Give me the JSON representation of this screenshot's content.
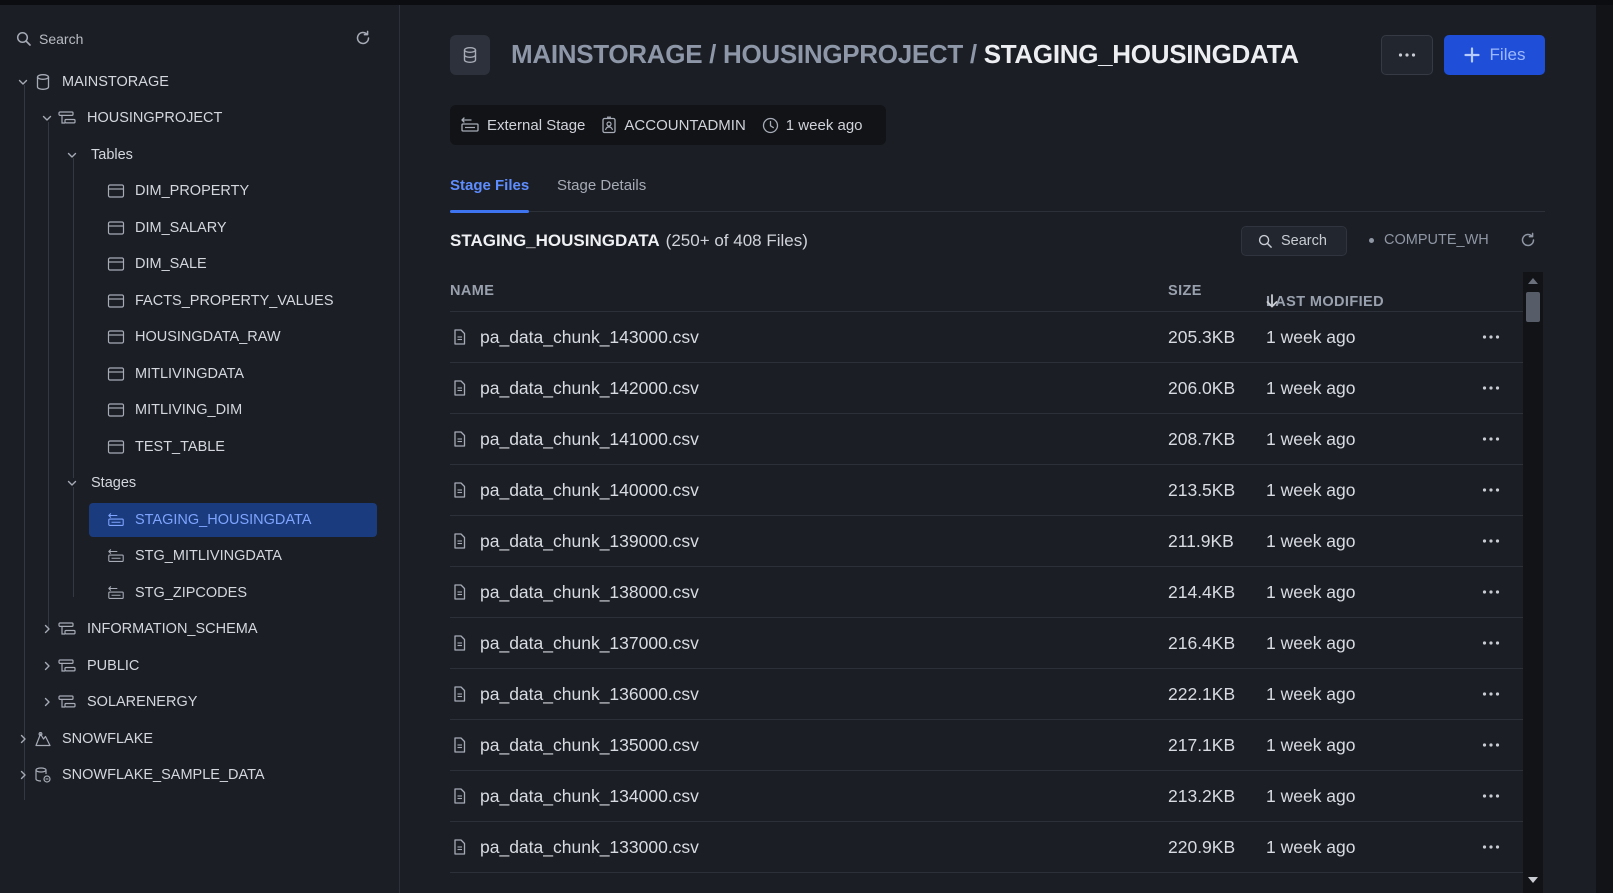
{
  "sidebar": {
    "search_placeholder": "Search",
    "tree": [
      {
        "label": "MAINSTORAGE",
        "icon": "database-icon",
        "expanded": true
      },
      {
        "label": "HOUSINGPROJECT",
        "icon": "schema-icon",
        "expanded": true
      },
      {
        "label": "Tables",
        "expanded": true
      },
      {
        "label": "DIM_PROPERTY",
        "icon": "table-icon"
      },
      {
        "label": "DIM_SALARY",
        "icon": "table-icon"
      },
      {
        "label": "DIM_SALE",
        "icon": "table-icon"
      },
      {
        "label": "FACTS_PROPERTY_VALUES",
        "icon": "table-icon"
      },
      {
        "label": "HOUSINGDATA_RAW",
        "icon": "table-icon"
      },
      {
        "label": "MITLIVINGDATA",
        "icon": "table-icon"
      },
      {
        "label": "MITLIVING_DIM",
        "icon": "table-icon"
      },
      {
        "label": "TEST_TABLE",
        "icon": "table-icon"
      },
      {
        "label": "Stages",
        "expanded": true
      },
      {
        "label": "STAGING_HOUSINGDATA",
        "icon": "stage-icon",
        "selected": true
      },
      {
        "label": "STG_MITLIVINGDATA",
        "icon": "stage-icon"
      },
      {
        "label": "STG_ZIPCODES",
        "icon": "stage-icon"
      },
      {
        "label": "INFORMATION_SCHEMA",
        "icon": "schema-icon",
        "expanded": false
      },
      {
        "label": "PUBLIC",
        "icon": "schema-icon",
        "expanded": false
      },
      {
        "label": "SOLARENERGY",
        "icon": "schema-icon",
        "expanded": false
      },
      {
        "label": "SNOWFLAKE",
        "icon": "share-icon",
        "expanded": false
      },
      {
        "label": "SNOWFLAKE_SAMPLE_DATA",
        "icon": "shared-database-icon",
        "expanded": false
      }
    ]
  },
  "header": {
    "crumb_1": "MAINSTORAGE / ",
    "crumb_2": "HOUSINGPROJECT / ",
    "current": "STAGING_HOUSINGDATA",
    "files_button": "Files"
  },
  "meta": {
    "stage_type": "External Stage",
    "owner": "ACCOUNTADMIN",
    "created": "1 week ago"
  },
  "tabs": {
    "stage_files": "Stage Files",
    "stage_details": "Stage Details"
  },
  "list": {
    "name": "STAGING_HOUSINGDATA",
    "count": "(250+ of 408 Files)",
    "search_label": "Search",
    "warehouse": "COMPUTE_WH"
  },
  "table": {
    "columns": {
      "name": "NAME",
      "size": "SIZE",
      "modified": "LAST MODIFIED"
    },
    "rows": [
      {
        "name": "pa_data_chunk_143000.csv",
        "size": "205.3KB",
        "modified": "1 week ago"
      },
      {
        "name": "pa_data_chunk_142000.csv",
        "size": "206.0KB",
        "modified": "1 week ago"
      },
      {
        "name": "pa_data_chunk_141000.csv",
        "size": "208.7KB",
        "modified": "1 week ago"
      },
      {
        "name": "pa_data_chunk_140000.csv",
        "size": "213.5KB",
        "modified": "1 week ago"
      },
      {
        "name": "pa_data_chunk_139000.csv",
        "size": "211.9KB",
        "modified": "1 week ago"
      },
      {
        "name": "pa_data_chunk_138000.csv",
        "size": "214.4KB",
        "modified": "1 week ago"
      },
      {
        "name": "pa_data_chunk_137000.csv",
        "size": "216.4KB",
        "modified": "1 week ago"
      },
      {
        "name": "pa_data_chunk_136000.csv",
        "size": "222.1KB",
        "modified": "1 week ago"
      },
      {
        "name": "pa_data_chunk_135000.csv",
        "size": "217.1KB",
        "modified": "1 week ago"
      },
      {
        "name": "pa_data_chunk_134000.csv",
        "size": "213.2KB",
        "modified": "1 week ago"
      },
      {
        "name": "pa_data_chunk_133000.csv",
        "size": "220.9KB",
        "modified": "1 week ago"
      }
    ]
  },
  "colors": {
    "background": "#1b1e24",
    "accent": "#1f4fd8",
    "selected": "#1a3b7d",
    "active_tab": "#5e8dff"
  }
}
